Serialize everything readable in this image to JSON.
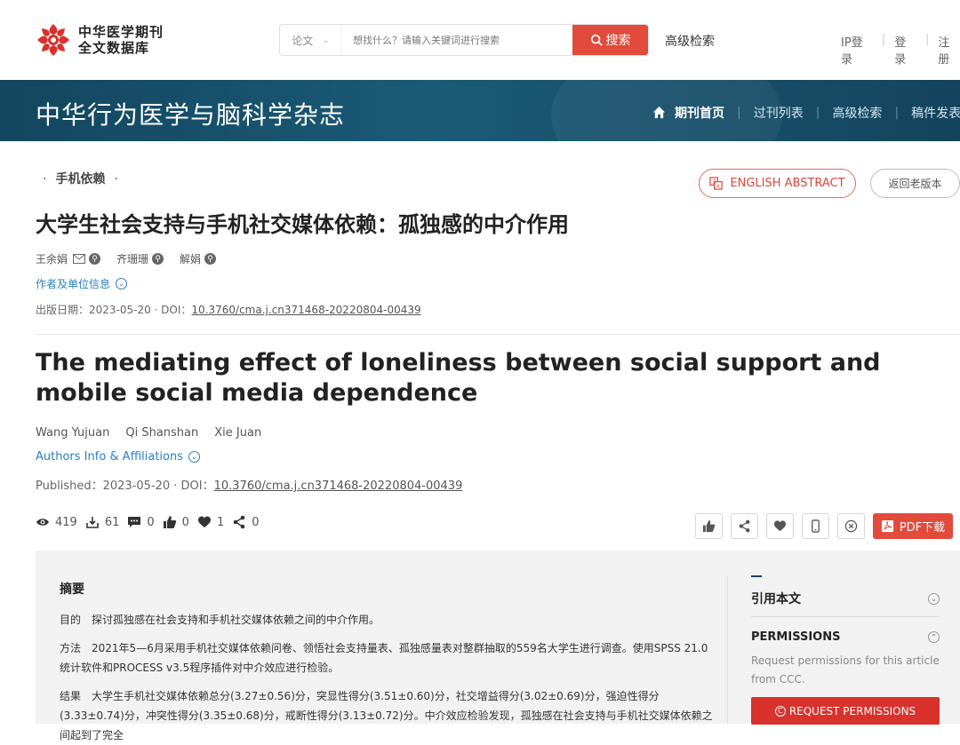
{
  "header": {
    "logo_line1": "中华医学期刊",
    "logo_line2": "全文数据库",
    "search_type": "论文",
    "search_placeholder": "想找什么？请输入关键词进行搜索",
    "search_button": "搜索",
    "advanced_search": "高级检索",
    "links": [
      "IP登录",
      "登录",
      "注册"
    ],
    "accent_color": "#e24a3b"
  },
  "banner": {
    "journal_title": "中华行为医学与脑科学杂志",
    "nav": [
      "期刊首页",
      "过刊列表",
      "高级检索",
      "稿件发表"
    ],
    "background": "#13465f"
  },
  "article": {
    "category": "手机依赖",
    "english_abstract_button": "ENGLISH ABSTRACT",
    "old_version_button": "返回老版本",
    "title_cn": "大学生社会支持与手机社交媒体依赖：孤独感的中介作用",
    "authors_cn": [
      "王余娟",
      "齐珊珊",
      "解娟"
    ],
    "affiliation_link_cn": "作者及单位信息",
    "published_cn_label": "出版日期：2023-05-20 · DOI：",
    "doi": "10.3760/cma.j.cn371468-20220804-00439",
    "title_en": "The mediating effect of loneliness between social support and mobile social media dependence",
    "authors_en": [
      "Wang Yujuan",
      "Qi Shanshan",
      "Xie Juan"
    ],
    "affiliation_link_en": "Authors Info & Affiliations",
    "published_en_label": "Published：2023-05-20 · DOI："
  },
  "stats": {
    "views": "419",
    "downloads": "61",
    "comments": "0",
    "likes": "0",
    "favorites": "1",
    "shares": "0"
  },
  "actions": {
    "pdf_download": "PDF下载"
  },
  "abstract": {
    "heading": "摘要",
    "objective_label": "目的",
    "objective": "探讨孤独感在社会支持和手机社交媒体依赖之间的中介作用。",
    "methods_label": "方法",
    "methods": "2021年5—6月采用手机社交媒体依赖问卷、领悟社会支持量表、孤独感量表对整群抽取的559名大学生进行调查。使用SPSS 21.0统计软件和PROCESS v3.5程序插件对中介效应进行检验。",
    "results_label": "结果",
    "results": "大学生手机社交媒体依赖总分(3.27±0.56)分，突显性得分(3.51±0.60)分，社交增益得分(3.02±0.69)分，强迫性得分(3.33±0.74)分，冲突性得分(3.35±0.68)分，戒断性得分(3.13±0.72)分。中介效应检验发现，孤独感在社会支持与手机社交媒体依赖之间起到了完全"
  },
  "sidebar": {
    "cite": "引用本文",
    "permissions_title": "PERMISSIONS",
    "permissions_desc": "Request permissions for this article from CCC.",
    "permissions_button": "REQUEST PERMISSIONS"
  }
}
